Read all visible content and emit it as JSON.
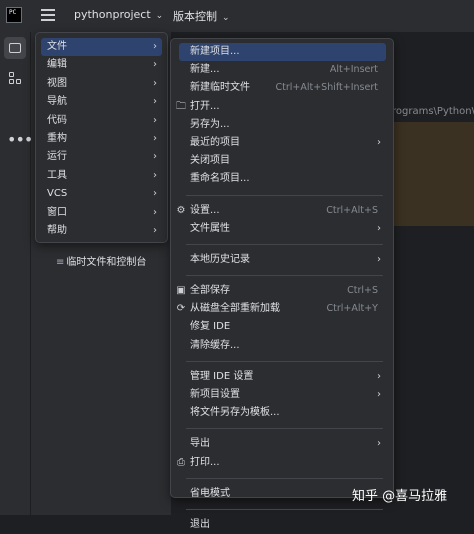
{
  "topbar": {
    "app_icon_text": "PC",
    "project_name": "pythonproject",
    "vcs_label": "版本控制"
  },
  "editor": {
    "path_fragment": "rograms\\Python\\"
  },
  "project_panel": {
    "scratch_label": "临时文件和控制台"
  },
  "main_menu": {
    "items": [
      {
        "label": "文件",
        "submenu": true
      },
      {
        "label": "编辑",
        "submenu": true
      },
      {
        "label": "视图",
        "submenu": true
      },
      {
        "label": "导航",
        "submenu": true
      },
      {
        "label": "代码",
        "submenu": true
      },
      {
        "label": "重构",
        "submenu": true
      },
      {
        "label": "运行",
        "submenu": true
      },
      {
        "label": "工具",
        "submenu": true
      },
      {
        "label": "VCS",
        "submenu": true
      },
      {
        "label": "窗口",
        "submenu": true
      },
      {
        "label": "帮助",
        "submenu": true
      }
    ]
  },
  "file_menu": {
    "new_project": "新建项目...",
    "new": "新建...",
    "new_shortcut": "Alt+Insert",
    "new_scratch": "新建临时文件",
    "new_scratch_shortcut": "Ctrl+Alt+Shift+Insert",
    "open": "打开...",
    "save_as": "另存为...",
    "recent_projects": "最近的项目",
    "close_project": "关闭项目",
    "rename_project": "重命名项目...",
    "settings": "设置...",
    "settings_shortcut": "Ctrl+Alt+S",
    "file_properties": "文件属性",
    "local_history": "本地历史记录",
    "save_all": "全部保存",
    "save_all_shortcut": "Ctrl+S",
    "reload_all": "从磁盘全部重新加载",
    "reload_all_shortcut": "Ctrl+Alt+Y",
    "repair_ide": "修复 IDE",
    "invalidate_caches": "清除缓存...",
    "manage_ide_settings": "管理 IDE 设置",
    "new_project_setup": "新项目设置",
    "save_file_as_template": "将文件另存为模板...",
    "export": "导出",
    "print": "打印...",
    "power_save_mode": "省电模式",
    "exit": "退出"
  },
  "watermark": "知乎 @喜马拉雅",
  "colors": {
    "highlight": "#2e436e",
    "menu_bg": "#2b2d30",
    "background": "#1e1f22"
  }
}
